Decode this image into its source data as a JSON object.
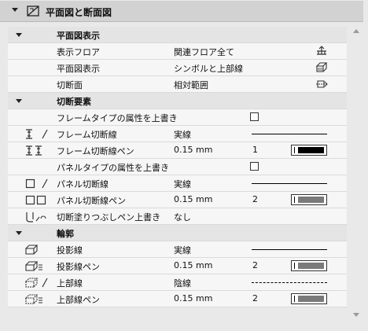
{
  "panel": {
    "title": "平面図と断面図",
    "header_icon": "floor-plan-section-icon"
  },
  "sections": {
    "plan": {
      "title": "平面図表示",
      "rows": [
        {
          "label": "表示フロア",
          "value": "関連フロア全て",
          "icon": "floors-icon"
        },
        {
          "label": "平面図表示",
          "value": "シンボルと上部線",
          "icon": "plan-display-icon"
        },
        {
          "label": "切断面",
          "value": "相対範囲",
          "icon": "cut-plane-icon"
        }
      ]
    },
    "cut": {
      "title": "切断要素",
      "override_frame": {
        "label": "フレームタイプの属性を上書き",
        "checked": false
      },
      "frame_line": {
        "label": "フレーム切断線",
        "value": "実線",
        "icon": "frame-cut-line-icon"
      },
      "frame_pen": {
        "label": "フレーム切断線ペン",
        "value": "0.15 mm",
        "pen_number": "1",
        "pen_color": "#000000",
        "icon": "frame-cut-pen-icon"
      },
      "override_panel": {
        "label": "パネルタイプの属性を上書き",
        "checked": false
      },
      "panel_line": {
        "label": "パネル切断線",
        "value": "実線",
        "icon": "panel-cut-line-icon"
      },
      "panel_pen": {
        "label": "パネル切断線ペン",
        "value": "0.15 mm",
        "pen_number": "2",
        "pen_color": "#7a7a7a",
        "icon": "panel-cut-pen-icon"
      },
      "fill_override": {
        "label": "切断塗りつぶしペン上書き",
        "value": "なし",
        "icon": "cut-fill-pen-icon"
      }
    },
    "outline": {
      "title": "輪郭",
      "proj_line": {
        "label": "投影線",
        "value": "実線",
        "icon": "projection-line-icon"
      },
      "proj_pen": {
        "label": "投影線ペン",
        "value": "0.15 mm",
        "pen_number": "2",
        "pen_color": "#7a7a7a",
        "icon": "projection-pen-icon"
      },
      "overhead_line": {
        "label": "上部線",
        "value": "陰線",
        "icon": "overhead-line-icon"
      },
      "overhead_pen": {
        "label": "上部線ペン",
        "value": "0.15 mm",
        "pen_number": "2",
        "pen_color": "#7a7a7a",
        "icon": "overhead-pen-icon"
      }
    }
  }
}
